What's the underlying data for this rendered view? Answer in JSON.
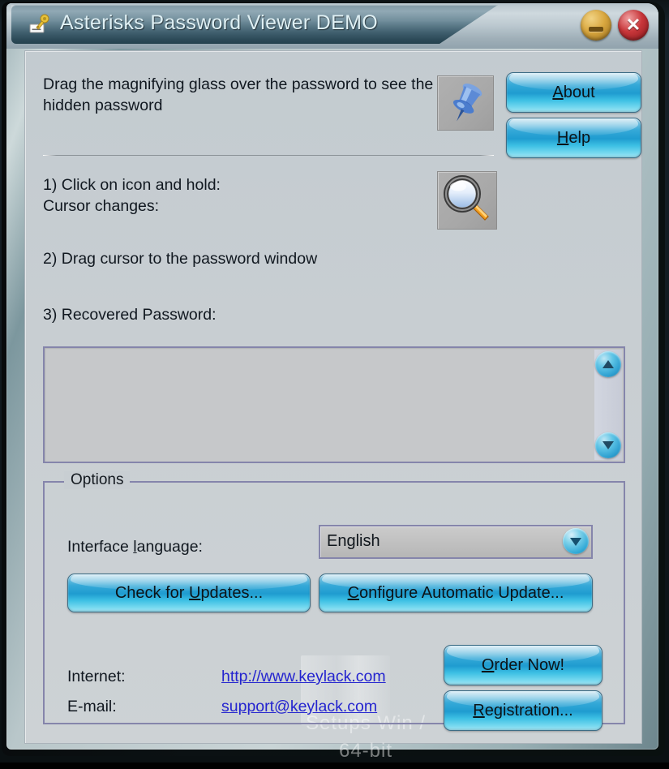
{
  "window": {
    "title": "Asterisks Password Viewer DEMO",
    "icon": "key-card-icon",
    "minimize_label": "Minimize",
    "close_glyph": "✕",
    "close_label": "Close",
    "accent_color": "#2d9fd0",
    "panel_color": "#c8ced2",
    "titlebar_color": "#41606f",
    "link_color": "#2424cf",
    "groupbox_border_color": "#8585ab"
  },
  "intro": {
    "text": "Drag the magnifying glass over the password to see the hidden password",
    "pin_icon": "push-pin-icon",
    "magnifier_icon": "magnifying-glass-icon"
  },
  "top_buttons": {
    "about": {
      "prefix": "",
      "accel": "A",
      "suffix": "bout"
    },
    "help": {
      "prefix": "",
      "accel": "H",
      "suffix": "elp"
    }
  },
  "steps": {
    "step1": "1) Click on icon and hold:\nCursor changes:",
    "step2": "2) Drag cursor to the password window",
    "step3": "3) Recovered Password:"
  },
  "result": {
    "value": "",
    "placeholder": "",
    "scroll_up_icon": "scroll-up-arrow-icon",
    "scroll_down_icon": "scroll-down-arrow-icon"
  },
  "options": {
    "legend": "Options",
    "language_label": {
      "prefix": "Interface ",
      "accel": "l",
      "suffix": "anguage:"
    },
    "language_value": "English",
    "language_options": [
      "English"
    ],
    "dropdown_icon": "chevron-down-icon",
    "check_updates": {
      "prefix": "Check for ",
      "accel": "U",
      "suffix": "pdates..."
    },
    "configure_update": {
      "prefix": "",
      "accel": "C",
      "suffix": "onfigure Automatic Update..."
    },
    "order_now": {
      "prefix": "",
      "accel": "O",
      "suffix": "rder Now!"
    },
    "registration": {
      "prefix": "",
      "accel": "R",
      "suffix": "egistration..."
    },
    "internet_label": "Internet:",
    "internet_link": "http://www.keylack.com",
    "email_label": "E-mail:",
    "email_link": "support@keylack.com"
  },
  "watermark": {
    "line1": "Setups Win /",
    "line2": "64-bit"
  }
}
